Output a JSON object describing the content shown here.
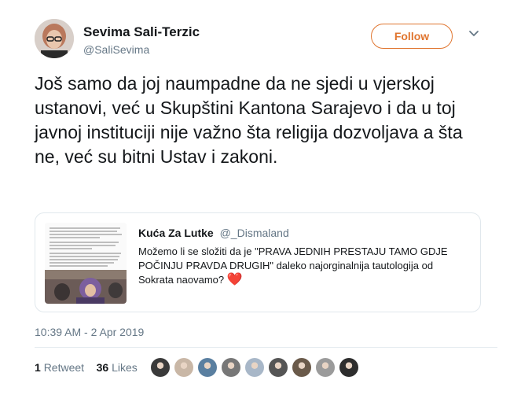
{
  "author": {
    "name": "Sevima Sali-Terzic",
    "handle": "@SaliSevima"
  },
  "follow_label": "Follow",
  "tweet_text": "Još samo da joj naumpadne da ne sjedi u vjerskoj ustanovi, već u Skupštini Kantona Sarajevo i da u toj javnoj instituciji nije važno šta religija dozvoljava a šta ne, već su bitni Ustav i zakoni.",
  "quoted": {
    "name": "Kuća Za Lutke",
    "handle": "@_Dismaland",
    "text": "Možemo li se složiti da je \"PRAVA JEDNIH PRESTAJU TAMO GDJE POČINJU PRAVDA DRUGIH\"  daleko najorginalnija tautologija od Sokrata naovamo?",
    "emoji": "❤️"
  },
  "timestamp": "10:39 AM - 2 Apr 2019",
  "stats": {
    "retweets": "1",
    "retweets_label": "Retweet",
    "likes": "36",
    "likes_label": "Likes"
  },
  "likers": [
    "#3a3a3a",
    "#c9b7a6",
    "#5a7fa0",
    "#777777",
    "#a8b7c8",
    "#555555",
    "#6a5a4a",
    "#9b9b9b",
    "#2d2d2d"
  ],
  "icons": {
    "chevron": "chevron-down-icon"
  }
}
